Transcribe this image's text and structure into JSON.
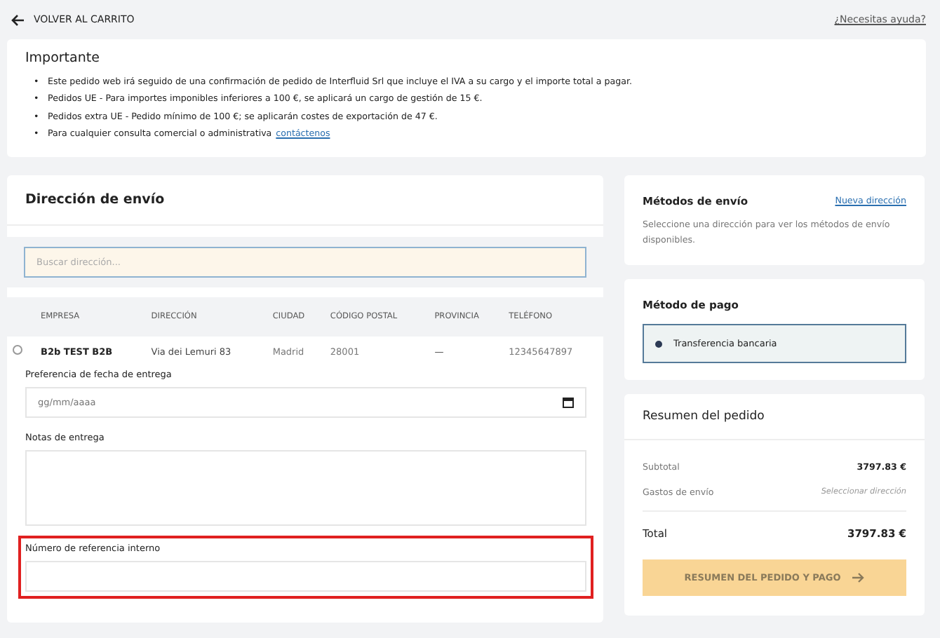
{
  "topbar": {
    "back_label": "VOLVER AL CARRITO",
    "help_link": "¿Necesitas ayuda?"
  },
  "notice": {
    "title": "Importante",
    "items": [
      {
        "bullet": "•",
        "text": "Este pedido web irá seguido de una confirmación de pedido de Interfluid Srl que incluye el IVA a su cargo y el importe total a pagar."
      },
      {
        "bullet": "•",
        "text": "Pedidos UE - Para importes imponibles inferiores a 100 €, se aplicará un cargo de gestión de 15 €."
      },
      {
        "bullet": "•",
        "text": "Pedidos extra UE - Pedido mínimo de 100 €; se aplicarán costes de exportación de 47 €."
      },
      {
        "bullet": "•",
        "text": "Para cualquier consulta comercial o administrativa",
        "link": "contáctenos"
      }
    ]
  },
  "shipping_address": {
    "title": "Dirección de envío",
    "search": {
      "placeholder": "Buscar dirección..."
    },
    "table": {
      "columns": [
        "EMPRESA",
        "DIRECCIÓN",
        "CIUDAD",
        "CÓDIGO POSTAL",
        "PROVINCIA",
        "TELÉFONO"
      ],
      "rows": [
        {
          "selected": false,
          "cells": [
            "B2b TEST B2B",
            "Via dei Lemuri 83",
            "Madrid",
            "28001",
            "—",
            "12345647897"
          ]
        }
      ]
    },
    "fields": [
      {
        "kind": "date",
        "label": "Preferencia de fecha de entrega",
        "placeholder": "gg/mm/aaaa",
        "highlighted": false
      },
      {
        "kind": "textarea",
        "label": "Notas de entrega",
        "highlighted": false
      },
      {
        "kind": "text",
        "label": "Número de referencia interno",
        "highlighted": true
      }
    ]
  },
  "shipping_methods": {
    "title": "Métodos de envío",
    "link": "Nueva dirección",
    "message": "Seleccione una dirección para ver los métodos de envío disponibles."
  },
  "payment": {
    "title": "Método de pago",
    "options": [
      {
        "label": "Transferencia bancaria",
        "selected": true
      }
    ]
  },
  "summary": {
    "title": "Resumen del pedido",
    "lines": [
      {
        "label": "Subtotal",
        "value": "3797.83 €",
        "kind": "amount"
      },
      {
        "label": "Gastos de envío",
        "value": "Seleccionar dirección",
        "kind": "hint"
      }
    ],
    "total": {
      "label": "Total",
      "value": "3797.83 €"
    },
    "button": {
      "label": "RESUMEN DEL PEDIDO Y PAGO",
      "disabled": true
    }
  }
}
